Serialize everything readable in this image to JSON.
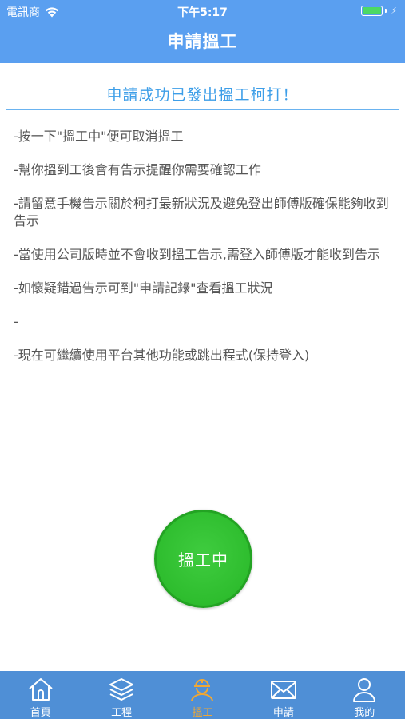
{
  "status_bar": {
    "carrier": "電訊商",
    "time": "下午5:17",
    "wifi_icon": "wifi-icon",
    "battery_icon": "battery-icon",
    "charging_icon": "charging-bolt-icon"
  },
  "header": {
    "title": "申請搵工"
  },
  "main": {
    "success_message": "申請成功已發出搵工柯打！",
    "notes": [
      "-按一下\"搵工中\"便可取消搵工",
      "-幫你搵到工後會有告示提醒你需要確認工作",
      "-請留意手機告示關於柯打最新狀況及避免登出師傅版確保能夠收到告示",
      "-當使用公司版時並不會收到搵工告示,需登入師傅版才能收到告示",
      "-如懷疑錯過告示可到\"申請記錄\"查看搵工狀況",
      "-",
      "-現在可繼續使用平台其他功能或跳出程式(保持登入)"
    ],
    "cancel_button_label": "搵工中"
  },
  "tab_bar": {
    "items": [
      {
        "label": "首頁",
        "icon": "home-icon"
      },
      {
        "label": "工程",
        "icon": "layers-icon"
      },
      {
        "label": "搵工",
        "icon": "worker-icon",
        "active": true
      },
      {
        "label": "申請",
        "icon": "mail-icon"
      },
      {
        "label": "我的",
        "icon": "user-icon"
      }
    ]
  },
  "colors": {
    "header_bg": "#5a9ff0",
    "accent_text": "#3d9ee8",
    "button_green": "#2ebd2e",
    "tab_bar_bg": "#4f8fd6",
    "tab_active": "#f0a733"
  }
}
